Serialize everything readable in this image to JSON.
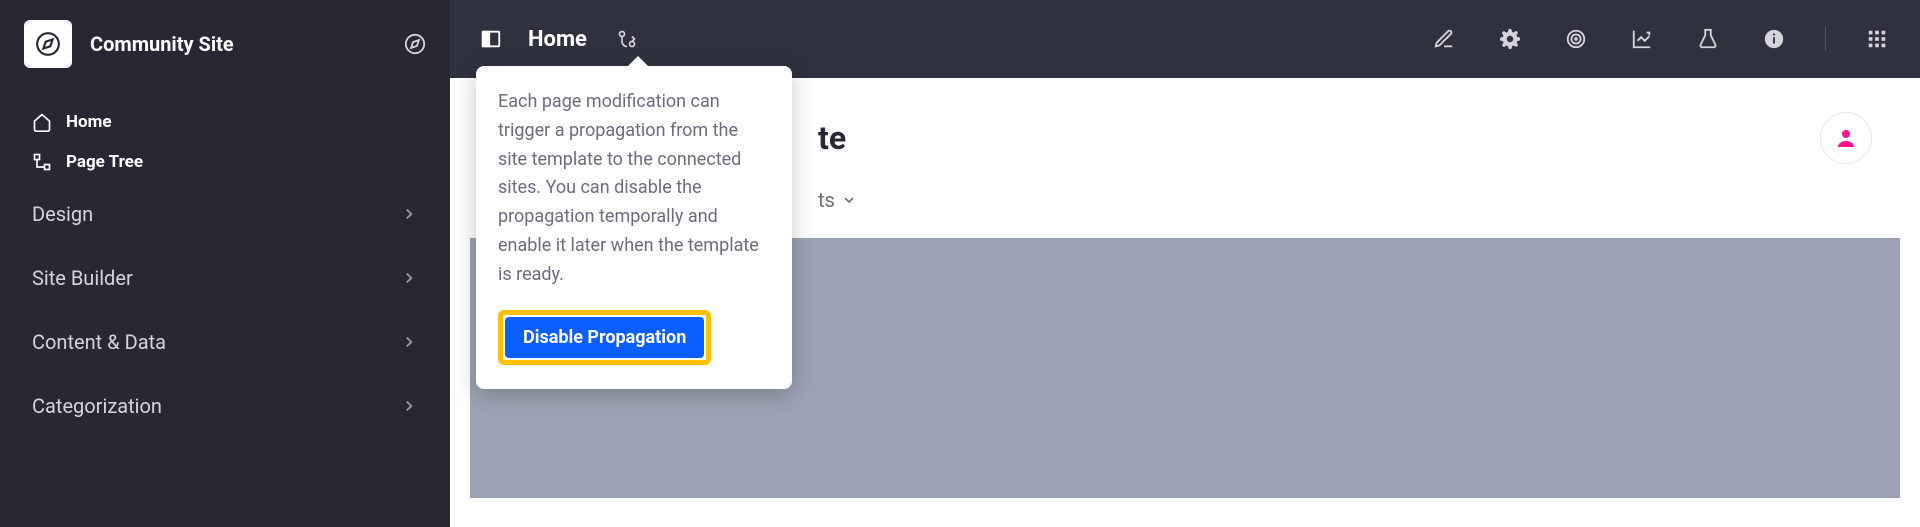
{
  "sidebar": {
    "site_title": "Community Site",
    "nav": [
      {
        "label": "Home",
        "icon": "home-icon"
      },
      {
        "label": "Page Tree",
        "icon": "page-tree-icon"
      }
    ],
    "sections": [
      {
        "label": "Design"
      },
      {
        "label": "Site Builder"
      },
      {
        "label": "Content & Data"
      },
      {
        "label": "Categorization"
      }
    ]
  },
  "topbar": {
    "title": "Home"
  },
  "content": {
    "title_suffix": "te",
    "sub_suffix": "ts"
  },
  "popover": {
    "text": "Each page modification can trigger a propagation from the site template to the connected sites. You can disable the propagation temporally and enable it later when the template is ready.",
    "button_label": "Disable Propagation"
  }
}
